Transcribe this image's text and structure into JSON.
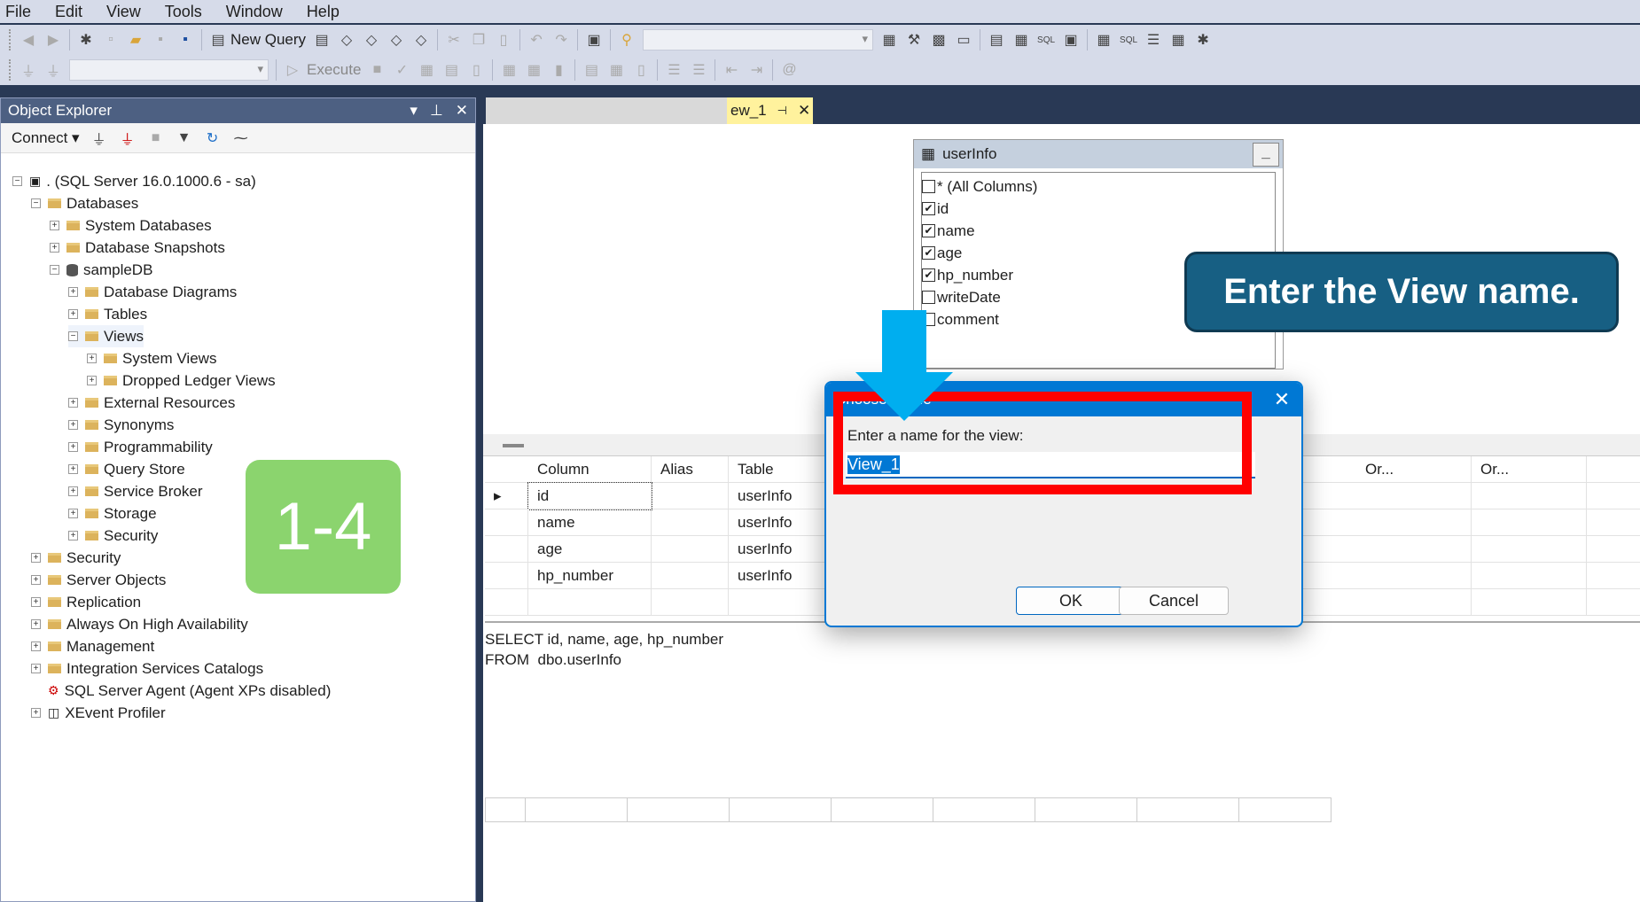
{
  "menu": [
    "File",
    "Edit",
    "View",
    "Tools",
    "Window",
    "Help"
  ],
  "toolbar": {
    "new_query": "New Query",
    "execute": "Execute"
  },
  "object_explorer": {
    "title": "Object Explorer",
    "connect": "Connect",
    "tree": [
      {
        "label": ". (SQL Server 16.0.1000.6 - sa)",
        "level": 0,
        "exp": "-",
        "icon": "server"
      },
      {
        "label": "Databases",
        "level": 1,
        "exp": "-",
        "icon": "folder"
      },
      {
        "label": "System Databases",
        "level": 2,
        "exp": "+",
        "icon": "folder"
      },
      {
        "label": "Database Snapshots",
        "level": 2,
        "exp": "+",
        "icon": "folder"
      },
      {
        "label": "sampleDB",
        "level": 2,
        "exp": "-",
        "icon": "database"
      },
      {
        "label": "Database Diagrams",
        "level": 3,
        "exp": "+",
        "icon": "folder"
      },
      {
        "label": "Tables",
        "level": 3,
        "exp": "+",
        "icon": "folder"
      },
      {
        "label": "Views",
        "level": 3,
        "exp": "-",
        "icon": "folder"
      },
      {
        "label": "System Views",
        "level": 4,
        "exp": "+",
        "icon": "folder"
      },
      {
        "label": "Dropped Ledger Views",
        "level": 4,
        "exp": "+",
        "icon": "folder"
      },
      {
        "label": "External Resources",
        "level": 3,
        "exp": "+",
        "icon": "folder"
      },
      {
        "label": "Synonyms",
        "level": 3,
        "exp": "+",
        "icon": "folder"
      },
      {
        "label": "Programmability",
        "level": 3,
        "exp": "+",
        "icon": "folder"
      },
      {
        "label": "Query Store",
        "level": 3,
        "exp": "+",
        "icon": "folder"
      },
      {
        "label": "Service Broker",
        "level": 3,
        "exp": "+",
        "icon": "folder"
      },
      {
        "label": "Storage",
        "level": 3,
        "exp": "+",
        "icon": "folder"
      },
      {
        "label": "Security",
        "level": 3,
        "exp": "+",
        "icon": "folder"
      },
      {
        "label": "Security",
        "level": 1,
        "exp": "+",
        "icon": "folder"
      },
      {
        "label": "Server Objects",
        "level": 1,
        "exp": "+",
        "icon": "folder"
      },
      {
        "label": "Replication",
        "level": 1,
        "exp": "+",
        "icon": "folder"
      },
      {
        "label": "Always On High Availability",
        "level": 1,
        "exp": "+",
        "icon": "folder"
      },
      {
        "label": "Management",
        "level": 1,
        "exp": "+",
        "icon": "folder"
      },
      {
        "label": "Integration Services Catalogs",
        "level": 1,
        "exp": "+",
        "icon": "folder"
      },
      {
        "label": "SQL Server Agent (Agent XPs disabled)",
        "level": 1,
        "exp": "",
        "icon": "agent"
      },
      {
        "label": "XEvent Profiler",
        "level": 1,
        "exp": "+",
        "icon": "profiler"
      }
    ]
  },
  "tab": {
    "label": "ew_1"
  },
  "table": {
    "name": "userInfo",
    "columns": [
      {
        "label": "* (All Columns)",
        "checked": false
      },
      {
        "label": "id",
        "checked": true
      },
      {
        "label": "name",
        "checked": true
      },
      {
        "label": "age",
        "checked": true
      },
      {
        "label": "hp_number",
        "checked": true
      },
      {
        "label": "writeDate",
        "checked": false
      },
      {
        "label": "comment",
        "checked": false
      }
    ]
  },
  "grid": {
    "headers": [
      "Column",
      "Alias",
      "Table",
      "Or...",
      "Or..."
    ],
    "rows": [
      [
        "id",
        "",
        "userInfo"
      ],
      [
        "name",
        "",
        "userInfo"
      ],
      [
        "age",
        "",
        "userInfo"
      ],
      [
        "hp_number",
        "",
        "userInfo"
      ]
    ]
  },
  "sql": [
    "SELECT id, name, age, hp_number",
    "FROM  dbo.userInfo"
  ],
  "dialog": {
    "title": "Choose Name",
    "label": "Enter a name for the view:",
    "value": "View_1",
    "ok": "OK",
    "cancel": "Cancel"
  },
  "annotation": {
    "callout": "Enter the View name.",
    "step": "1-4",
    "callout_color": "#175f83",
    "badge_color": "#8bd46e",
    "highlight_color": "#ff0000",
    "arrow_color": "#00aeef"
  }
}
